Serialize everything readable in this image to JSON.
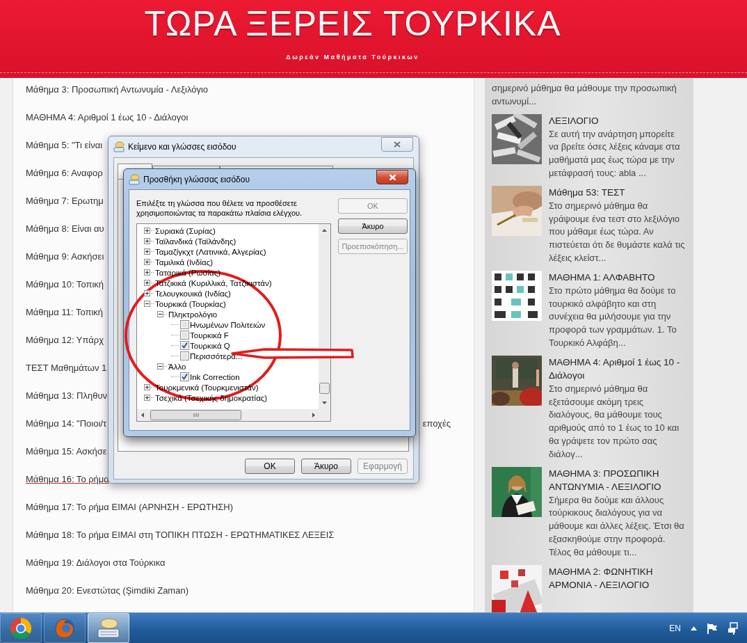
{
  "header": {
    "title": "ΤΩΡΑ ΞΕΡΕΙΣ ΤΟΥΡΚΙΚΑ",
    "subtitle": "Δωρεάν Μαθήματα Τούρκικων"
  },
  "lessons": [
    {
      "text": "Μάθημα 3: Προσωπική Αντωνυμία - Λεξιλόγιο",
      "underlined": false
    },
    {
      "text": "ΜΑΘΗΜΑ 4: Αριθμοί 1 έως 10 - Διάλογοι",
      "underlined": false
    },
    {
      "text": "Μάθημα 5: \"Τι είναι",
      "underlined": false
    },
    {
      "text": "Μάθημα 6: Αναφορ",
      "underlined": false
    },
    {
      "text": "Μάθημα 7: Ερωτημ",
      "underlined": false
    },
    {
      "text": "Μάθημα 8: Είναι αυ",
      "underlined": false
    },
    {
      "text": "Μάθημα 9: Ασκήσει",
      "underlined": false
    },
    {
      "text": "Μάθημα 10: Τοπική",
      "underlined": false
    },
    {
      "text": "Μάθημα 11: Τοπική",
      "underlined": false
    },
    {
      "text": "Μάθημα 12: Υπάρχ",
      "underlined": false
    },
    {
      "text": "ΤΕΣΤ Μαθημάτων 1",
      "underlined": false
    },
    {
      "text": "Μάθημα 13: Πληθυν",
      "underlined": false
    },
    {
      "text": "Μάθημα 14: \"Ποιοι/τ",
      "text_after": "εποχές",
      "underlined": false
    },
    {
      "text": "Μάθημα 15: Ασκήσε",
      "underlined": false
    },
    {
      "text": "Μάθημα 16: Το ρήμα",
      "underlined": true
    },
    {
      "text": "Μάθημα 17: Το ρήμα ΕΙΜΑΙ (ΑΡΝΗΣΗ - ΕΡΩΤΗΣΗ)",
      "underlined": false
    },
    {
      "text": "Μάθημα 18: Το ρήμα ΕΙΜΑΙ στη ΤΟΠΙΚΗ ΠΤΩΣΗ - ΕΡΩΤΗΜΑΤΙΚΕΣ ΛΕΞΕΙΣ",
      "underlined": false
    },
    {
      "text": "Μάθημα 19: Διάλογοι στα Τούρκικα",
      "underlined": false
    },
    {
      "text": "Μάθημα 20: Ενεστώτας (Şimdiki Zaman)",
      "underlined": false
    }
  ],
  "sidebar": {
    "intro": "σημερινό μάθημα θα μάθουμε την προσωπική αντωνυμί...",
    "posts": [
      {
        "title": "ΛΕΞΙΛΟΓΙΟ",
        "snippet": "Σε αυτή την ανάρτηση μπορείτε να βρείτε όσες λέξεις κάναμε στα μαθήματά μας έως τώρα με την μετάφρασή τους: abla ..."
      },
      {
        "title": "Μάθημα 53: ΤΕΣΤ",
        "snippet": "Στο σημερινό μάθημα θα γράψουμε ένα τεστ στο λεξιλόγιο που μάθαμε έως τώρα.  Αν πιστεύεται ότι δε θυμάστε καλά τις λέξεις κλείστ..."
      },
      {
        "title": "ΜΑΘΗΜΑ 1: ΑΛΦΑΒΗΤΟ",
        "snippet": "Στο πρώτο μάθημα θα δούμε το τουρκικό αλφάβητο και στη συνέχεια θα μιλήσουμε για την προφορά των γραμμάτων. 1. Το Τουρκικό Αλφάβη..."
      },
      {
        "title": "ΜΑΘΗΜΑ 4: Αριθμοί 1 έως 10 - Διάλογοι",
        "snippet": "Στο σημερινό μάθημα θα εξετάσουμε ακόμη τρεις διαλόγους, θα μάθουμε τους αριθμούς από το 1 έως το 10 και θα γράψετε τον πρώτο σας διάλογ..."
      },
      {
        "title": "ΜΑΘΗΜΑ 3: ΠΡΟΣΩΠΙΚΗ ΑΝΤΩΝΥΜΙΑ - ΛΕΞΙΛΟΓΙΟ",
        "snippet": "Σήμερα θα δούμε και άλλους τούρκικους διαλόγους για να μάθουμε και άλλες λέξεις.  Έτσι θα εξασκηθούμε στην προφορά.  Τέλος θα μάθουμε τι..."
      },
      {
        "title": "ΜΑΘΗΜΑ 2: ΦΩΝΗΤΙΚΗ ΑΡΜΟΝΙΑ - ΛΕΞΙΛΟΓΙΟ"
      }
    ]
  },
  "dialog_back": {
    "title": "Κείμενο και γλώσσες εισόδου",
    "tabs": [
      {
        "selected": true
      },
      {
        "selected": false
      },
      {
        "selected": false
      }
    ],
    "buttons": [
      {
        "label": "OK",
        "disabled": false
      },
      {
        "label": "Άκυρο",
        "disabled": false
      },
      {
        "label": "Εφαρμογή",
        "disabled": true
      }
    ]
  },
  "dialog_front": {
    "title": "Προσθήκη γλώσσας εισόδου",
    "instructions": "Επιλέξτε τη γλώσσα που θέλετε να προσθέσετε χρησιμοποιώντας τα παρακάτω πλαίσια ελέγχου.",
    "buttons": [
      {
        "label": "OK",
        "disabled": true
      },
      {
        "label": "Άκυρο",
        "disabled": false
      },
      {
        "label": "Προεπισκόπηση...",
        "disabled": true
      }
    ],
    "tree": [
      {
        "kind": "group",
        "label": "Συριακά (Συρίας)",
        "expanded": false
      },
      {
        "kind": "group",
        "label": "Ταϊλανδικά (Ταϊλάνδης)",
        "expanded": false
      },
      {
        "kind": "group",
        "label": "Ταμαζίγκχτ (Λατινικά, Αλγερίας)",
        "expanded": false
      },
      {
        "kind": "group",
        "label": "Ταμιλικά (Ινδίας)",
        "expanded": false
      },
      {
        "kind": "group",
        "label": "Ταταρικά (Ρωσίας)",
        "expanded": false
      },
      {
        "kind": "group",
        "label": "Τατζικικά (Κυριλλικά, Τατζικιστάν)",
        "expanded": false
      },
      {
        "kind": "group",
        "label": "Τελουγκουικά (Ινδίας)",
        "expanded": false
      },
      {
        "kind": "group",
        "label": "Τουρκικά (Τουρκίας)",
        "expanded": true,
        "children": [
          {
            "kind": "group",
            "label": "Πληκτρολόγιο",
            "expanded": true,
            "children": [
              {
                "kind": "option",
                "label": "Ηνωμένων Πολιτειών",
                "checked": false
              },
              {
                "kind": "option",
                "label": "Τουρκικά F",
                "checked": false
              },
              {
                "kind": "option",
                "label": "Τουρκικά Q",
                "checked": true
              },
              {
                "kind": "option",
                "label": "Περισσότερα...",
                "checked": false
              }
            ]
          },
          {
            "kind": "group",
            "label": "Άλλο",
            "expanded": true,
            "children": [
              {
                "kind": "option",
                "label": "Ink Correction",
                "checked": true
              }
            ]
          }
        ]
      },
      {
        "kind": "group",
        "label": "Τουρκμενικά (Τουρκμενιστάν)",
        "expanded": false
      },
      {
        "kind": "group",
        "label": "Τσεχικά (Τσεχικής δημοκρατίας)",
        "expanded": false
      }
    ]
  },
  "taskbar": {
    "apps": [
      {
        "kind": "chrome",
        "active": false
      },
      {
        "kind": "firefox",
        "active": false
      },
      {
        "kind": "keyboard",
        "active": true
      }
    ],
    "language": "EN"
  }
}
